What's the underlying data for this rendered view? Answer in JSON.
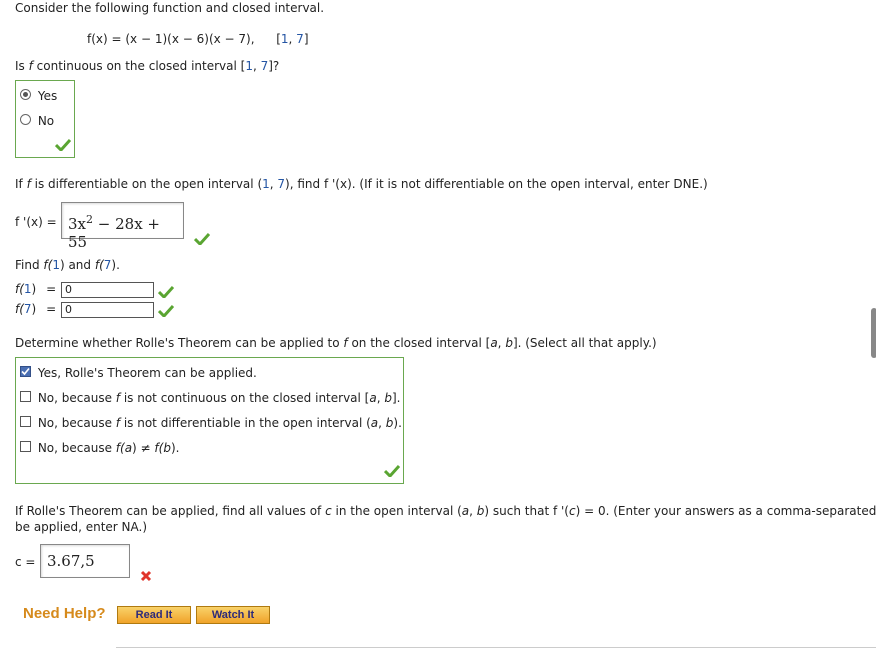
{
  "intro": "Consider the following function and closed interval.",
  "function_def": {
    "lhs": "f(x) = (x − 1)(x − 6)(x − 7),",
    "interval_open": "[",
    "a": "1",
    "comma": ", ",
    "b": "7",
    "interval_close": "]"
  },
  "q1": {
    "pre": "Is ",
    "f": "f",
    "mid": " continuous on the closed interval ",
    "bracket_open": "[",
    "a": "1",
    "comma": ", ",
    "b": "7",
    "bracket_close": "]?",
    "options": [
      {
        "label": "Yes",
        "selected": true
      },
      {
        "label": "No",
        "selected": false
      }
    ]
  },
  "q2": {
    "pre": "If ",
    "f": "f",
    "mid": " is differentiable on the open interval ",
    "paren_open": "(",
    "a": "1",
    "comma": ", ",
    "b": "7",
    "paren_close": ")",
    "rest": ", find f '(x). (If it is not differentiable on the open interval, enter DNE.)",
    "answer_label": "f '(x) =",
    "answer_base": "3x",
    "answer_exp": "2",
    "answer_rest": " − 28x + 55"
  },
  "q3": {
    "prompt_pre": "Find ",
    "prompt_f1": "f(",
    "prompt_1": "1",
    "prompt_close1": ")",
    "prompt_and": " and ",
    "prompt_f7": "f(",
    "prompt_7": "7",
    "prompt_close7": ").",
    "row1_label_f": "f(",
    "row1_label_n": "1",
    "row1_label_close": ")",
    "row1_eq": "=",
    "row1_value": "0",
    "row2_label_f": "f(",
    "row2_label_n": "7",
    "row2_label_close": ")",
    "row2_eq": "=",
    "row2_value": "0"
  },
  "q4": {
    "prompt": "Determine whether Rolle's Theorem can be applied to ",
    "f": "f",
    "prompt_mid": " on the closed interval [",
    "a": "a",
    "comma": ", ",
    "b": "b",
    "prompt_end": "]. (Select all that apply.)",
    "options": [
      {
        "text": "Yes, Rolle's Theorem can be applied.",
        "checked": true
      },
      {
        "text_pre": "No, because ",
        "f": "f",
        "text_mid": " is not continuous on the closed interval [",
        "a": "a",
        "comma": ", ",
        "b": "b",
        "text_end": "].",
        "checked": false
      },
      {
        "text_pre": "No, because ",
        "f": "f",
        "text_mid": " is not differentiable in the open interval (",
        "a": "a",
        "comma": ", ",
        "b": "b",
        "text_end": ").",
        "checked": false
      },
      {
        "text_pre": "No, because ",
        "fa": "f(",
        "a": "a",
        "close_a": ")",
        "neq": " ≠ ",
        "fb": "f(",
        "b": "b",
        "close_b": ").",
        "checked": false
      }
    ]
  },
  "q5": {
    "line1_pre": "If Rolle's Theorem can be applied, find all values of ",
    "c": "c",
    "line1_mid": " in the open interval (",
    "a": "a",
    "comma": ", ",
    "b": "b",
    "line1_mid2": ") such that f '(",
    "c2": "c",
    "line1_end": ") = 0. (Enter your answers as a comma-separated",
    "line2": "be applied, enter NA.)",
    "answer_label": "c =",
    "answer_value": "3.67,5"
  },
  "help": {
    "label": "Need Help?",
    "read_it": "Read It",
    "watch_it": "Watch It"
  },
  "colors": {
    "correct": "#5aa532",
    "incorrect": "#e0352b",
    "highlight_blue": "#2455a4",
    "help_orange": "#d68a1c"
  }
}
